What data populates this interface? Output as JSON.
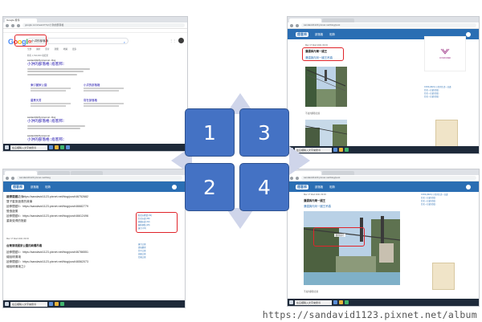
{
  "shot1": {
    "tab_label": "Google 搜尋",
    "url": "google.com/search?q=小洪的部落格",
    "search_query": "小洪的部落格",
    "logo": "Google",
    "search_tabs": [
      "全部",
      "圖片",
      "影片",
      "新聞",
      "地圖",
      "更多"
    ],
    "stats": "約有 1,530,000 項結果",
    "results": [
      {
        "cite": "sandavid1123.pixnet.net › blog",
        "title": "小洪的部落格::痞客邦::"
      },
      {
        "cite": "sandavid1123.pixnet.net › blog",
        "title": "小洪的部落格::痞客邦::"
      },
      {
        "cite": "sandavid1123.pixnet.net",
        "title": "小洪的部落格::痞客邦::"
      }
    ],
    "sitelinks": [
      "東引國家公園",
      "小洪的部落格",
      "農業天書",
      "寫在部落格"
    ],
    "taskbar_search": "在這裡輸入文字來搜尋"
  },
  "shot2": {
    "url": "sandavid1123.pixnet.net/blog",
    "lines": [
      "離開嘉義之後",
      "延伸閱讀2：https://sandavid1123.pixnet.net/blog/post/46752682",
      "雙子星旅遊書的故事",
      "延伸閱讀3：https://sandavid1123.pixnet.net/blog/post/46682779",
      "營造遊樂",
      "延伸閱讀4：https://sandavid1123.pixnet.net/blog/post/46612496",
      "重新覺得的陰影"
    ],
    "post_meta": "Mar 17 Wed 2021 09:03",
    "post_title": "台灣清境國家公園的絢爛吊橋",
    "lines_b": [
      "延伸閱讀1：https://sandavid1123.pixnet.net/blog/post/46786551",
      "總說明清境",
      "延伸閱讀2：https://sandavid1123.pixnet.net/blog/post/46562073",
      "總說明清境之2"
    ],
    "side_links": [
      "新北市產業 (32)",
      "台北市遊 (38)",
      "桃園市遊 (32)",
      "國內景點 (26)",
      "東引 (15)"
    ],
    "side_links_b": [
      "東引之旅",
      "清境農場",
      "台中之旅",
      "高雄之旅",
      "台東之旅"
    ],
    "taskbar_search": "在這裡輸入文字來搜尋"
  },
  "shot3": {
    "url": "sandavid1123.pixnet.net/blog/post",
    "logo": "痞客邦",
    "menu": [
      "首頁",
      "部落格",
      "相簿"
    ],
    "post_meta": "Mar 17 Wed 2021 09:03",
    "post_title": "瀰濃與內灣一國王",
    "post_link": "瀰濃與內灣一國王吊橋",
    "caption": "不如的鋼筋走廊",
    "ad_text": "COSMOMED",
    "side_links": [
      "COOL(2021) 小洪的生活一日遊",
      "台北一日遊(北投)",
      "台北一日遊(北投)",
      "台北一日遊(北投)",
      "台北一日遊(北投)"
    ],
    "taskbar_search": "在這裡輸入文字來搜尋"
  },
  "shot4": {
    "url": "sandavid1123.pixnet.net/blog/post",
    "logo": "痞客邦",
    "menu": [
      "首頁",
      "部落格",
      "相簿"
    ],
    "post_meta": "Mar 17 Wed 2021 09:03",
    "post_title": "瀰濃與內灣一國王",
    "post_link": "瀰濃與內灣一國王吊橋",
    "photo_label": "聯邦銀行",
    "caption": "不如的鋼筋走廊",
    "side_links": [
      "COOL(2021) 小洪的生活一日遊",
      "台北一日遊(北投)",
      "台北一日遊(北投)",
      "台北一日遊(北投)"
    ],
    "taskbar_search": "在這裡輸入文字來搜尋"
  },
  "tiles": [
    "1",
    "3",
    "2",
    "4"
  ],
  "watermark": "https://sandavid1123.pixnet.net/album",
  "colors": {
    "accent": "#4472c4",
    "highlight": "#e0242a",
    "blog_header": "#2a6eb3"
  }
}
